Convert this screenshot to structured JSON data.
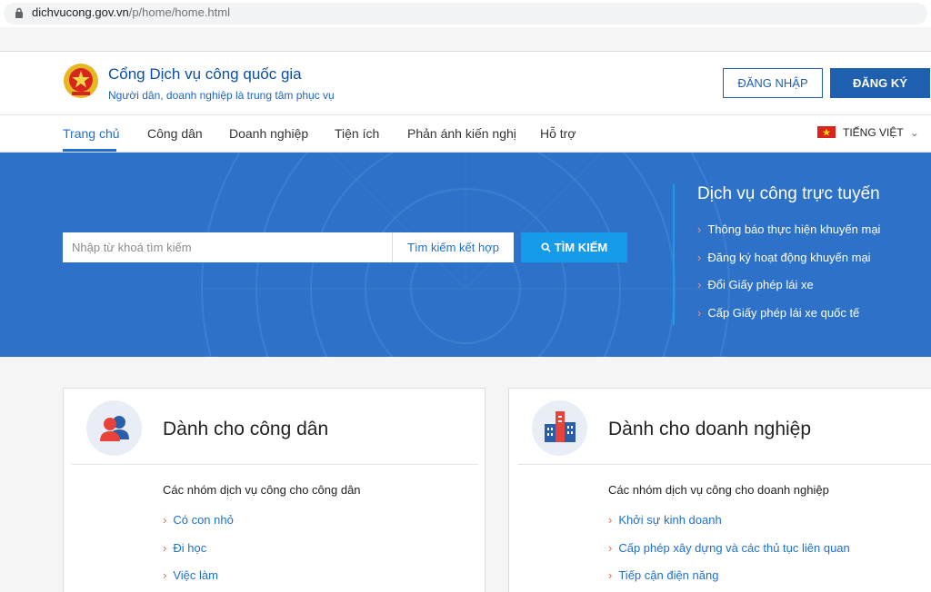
{
  "browser": {
    "url_host": "dichvucong.gov.vn",
    "url_path": "/p/home/home.html"
  },
  "header": {
    "title": "Cổng Dịch vụ công quốc gia",
    "subtitle": "Người dân, doanh nghiệp là trung tâm phục vụ",
    "login_label": "ĐĂNG NHẬP",
    "register_label": "ĐĂNG KÝ"
  },
  "nav": {
    "items": [
      "Trang chủ",
      "Công dân",
      "Doanh nghiệp",
      "Tiện ích",
      "Phản ánh kiến nghị",
      "Hỗ trợ"
    ],
    "active": "Trang chủ",
    "language": "TIẾNG VIỆT"
  },
  "search": {
    "placeholder": "Nhập từ khoá tìm kiếm",
    "advanced_label": "Tìm kiếm kết hợp",
    "button_label": "TÌM KIẾM"
  },
  "online_services": {
    "title": "Dịch vụ công trực tuyến",
    "items": [
      "Thông báo thực hiện khuyến mại",
      "Đăng ký hoạt động khuyến mại",
      "Đổi Giấy phép lái xe",
      "Cấp Giấy phép lái xe quốc tế"
    ]
  },
  "cards": [
    {
      "title": "Dành cho công dân",
      "subtitle": "Các nhóm dịch vụ công cho công dân",
      "links": [
        "Có con nhỏ",
        "Đi học",
        "Việc làm"
      ]
    },
    {
      "title": "Dành cho doanh nghiệp",
      "subtitle": "Các nhóm dịch vụ công cho doanh nghiệp",
      "links": [
        "Khởi sự kinh doanh",
        "Cấp phép xây dựng và các thủ tục liên quan",
        "Tiếp cận điện năng"
      ]
    }
  ],
  "colors": {
    "primary": "#1f5faf",
    "hero_bg": "#2d72c8",
    "search_button": "#159be9",
    "link": "#1e6fd0",
    "accent_arrow": "#e26a5a"
  },
  "icons": {
    "lock": "lock-icon",
    "emblem": "national-emblem",
    "flag": "vietnam-flag-icon",
    "search": "search-icon",
    "citizen": "citizen-icon",
    "business": "business-building-icon"
  }
}
